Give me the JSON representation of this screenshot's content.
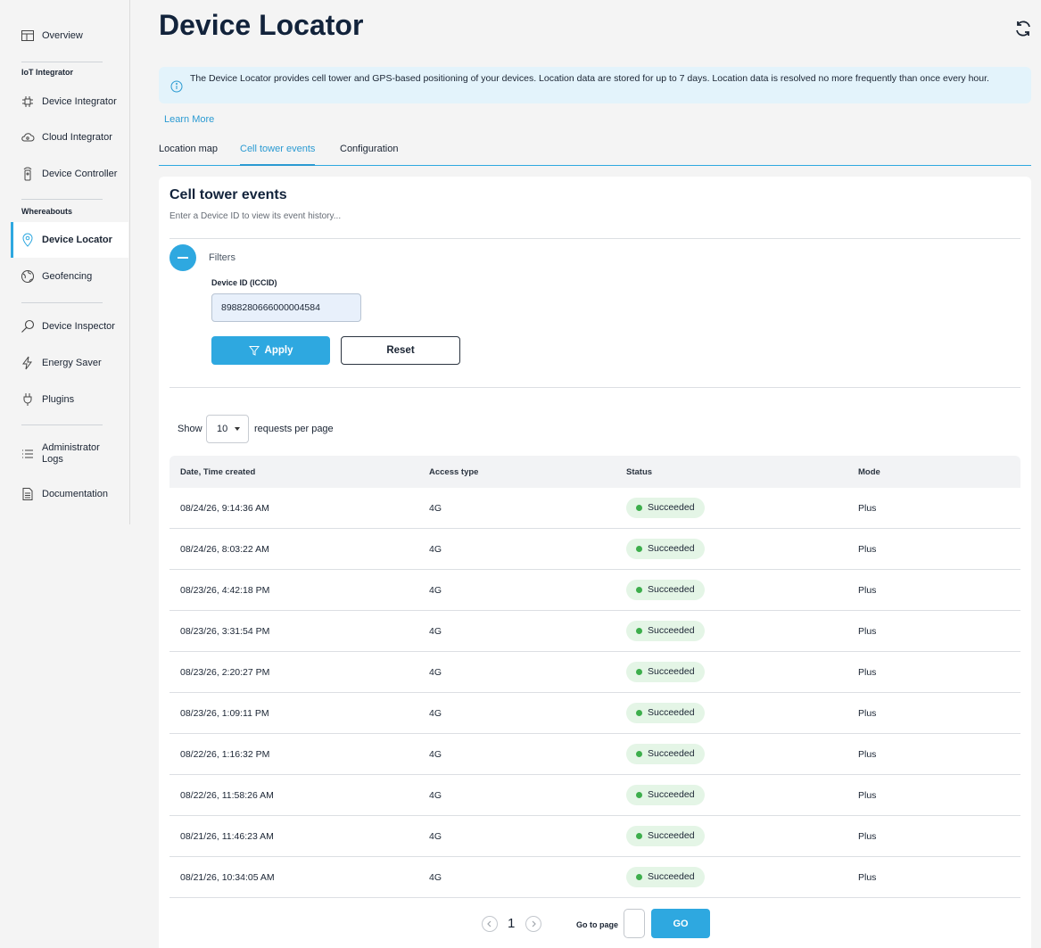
{
  "sidebar": {
    "overview": "Overview",
    "section_iot": "IoT Integrator",
    "device_integrator": "Device Integrator",
    "cloud_integrator": "Cloud Integrator",
    "device_controller": "Device Controller",
    "section_whereabouts": "Whereabouts",
    "device_locator": "Device Locator",
    "geofencing": "Geofencing",
    "device_inspector": "Device Inspector",
    "energy_saver": "Energy Saver",
    "plugins": "Plugins",
    "admin_logs_line1": "Administrator",
    "admin_logs_line2": "Logs",
    "documentation": "Documentation"
  },
  "header": {
    "title": "Device Locator",
    "info": "The Device Locator provides cell tower and GPS-based positioning of your devices. Location data are stored for up to 7 days. Location data is resolved no more frequently than once every hour.",
    "learn_more": "Learn More"
  },
  "tabs": {
    "location_map": "Location map",
    "cell_tower_events": "Cell tower events",
    "configuration": "Configuration"
  },
  "card": {
    "title": "Cell tower events",
    "subtitle": "Enter a Device ID to view its event history...",
    "filters_label": "Filters",
    "device_id_label": "Device ID (ICCID)",
    "device_id_value": "8988280666000004584",
    "apply": "Apply",
    "reset": "Reset",
    "show": "Show",
    "page_size": "10",
    "requests_per_page": "requests per page"
  },
  "table": {
    "headers": {
      "date": "Date, Time created",
      "access": "Access type",
      "status": "Status",
      "mode": "Mode"
    },
    "rows": [
      {
        "date": "08/24/26, 9:14:36 AM",
        "access": "4G",
        "status": "Succeeded",
        "mode": "Plus"
      },
      {
        "date": "08/24/26, 8:03:22 AM",
        "access": "4G",
        "status": "Succeeded",
        "mode": "Plus"
      },
      {
        "date": "08/23/26, 4:42:18 PM",
        "access": "4G",
        "status": "Succeeded",
        "mode": "Plus"
      },
      {
        "date": "08/23/26, 3:31:54 PM",
        "access": "4G",
        "status": "Succeeded",
        "mode": "Plus"
      },
      {
        "date": "08/23/26, 2:20:27 PM",
        "access": "4G",
        "status": "Succeeded",
        "mode": "Plus"
      },
      {
        "date": "08/23/26, 1:09:11 PM",
        "access": "4G",
        "status": "Succeeded",
        "mode": "Plus"
      },
      {
        "date": "08/22/26, 1:16:32 PM",
        "access": "4G",
        "status": "Succeeded",
        "mode": "Plus"
      },
      {
        "date": "08/22/26, 11:58:26 AM",
        "access": "4G",
        "status": "Succeeded",
        "mode": "Plus"
      },
      {
        "date": "08/21/26, 11:46:23 AM",
        "access": "4G",
        "status": "Succeeded",
        "mode": "Plus"
      },
      {
        "date": "08/21/26, 10:34:05 AM",
        "access": "4G",
        "status": "Succeeded",
        "mode": "Plus"
      }
    ]
  },
  "pager": {
    "current": "1",
    "goto_label": "Go to page",
    "go": "GO"
  },
  "colors": {
    "accent": "#2ea8e0",
    "success": "#3dae4c",
    "banner": "#e3f3fb"
  }
}
